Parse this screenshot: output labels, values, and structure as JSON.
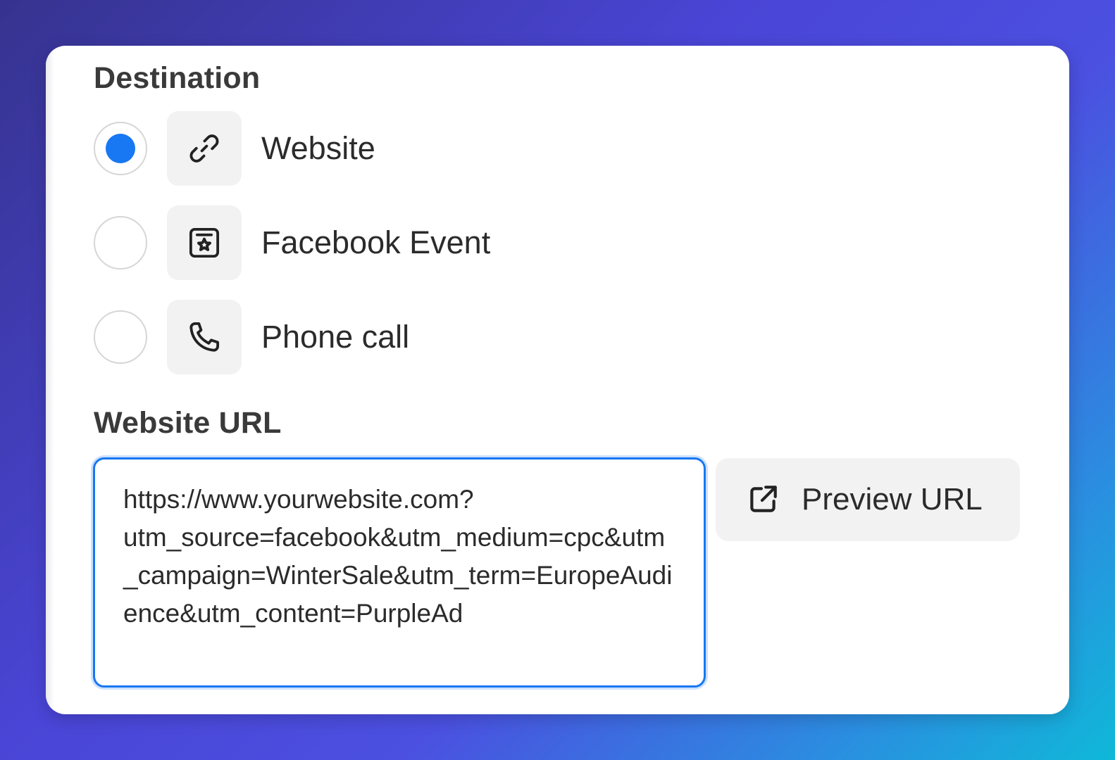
{
  "destination": {
    "title": "Destination",
    "selected": "website",
    "options": [
      {
        "id": "website",
        "label": "Website",
        "icon": "link-icon",
        "selected": true
      },
      {
        "id": "facebook_event",
        "label": "Facebook Event",
        "icon": "calendar-star-icon",
        "selected": false
      },
      {
        "id": "phone_call",
        "label": "Phone call",
        "icon": "phone-icon",
        "selected": false
      }
    ]
  },
  "website_url": {
    "title": "Website URL",
    "value": "https://www.yourwebsite.com?\nutm_source=facebook&utm_medium=cpc&utm_campaign=WinterSale&utm_term=EuropeAudience&utm_content=PurpleAd",
    "preview_label": "Preview URL",
    "preview_icon": "external-link-icon"
  },
  "colors": {
    "accent": "#1877f2",
    "icon_bg": "#f2f2f2",
    "text": "#2b2b2b"
  }
}
